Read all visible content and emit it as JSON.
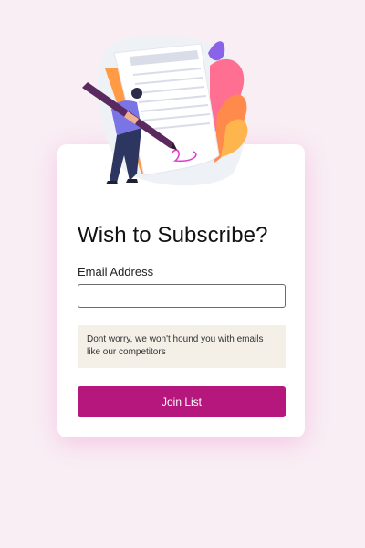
{
  "form": {
    "title": "Wish to Subscribe?",
    "email_label": "Email Address",
    "email_value": "",
    "email_placeholder": "",
    "notice": "Dont worry, we won't hound you with emails like our competitors",
    "button_label": "Join List"
  },
  "colors": {
    "background": "#f9eef4",
    "card": "#ffffff",
    "accent": "#b5177d",
    "notice_bg": "#f4f0e8"
  },
  "illustration": {
    "icon": "person-signing-document-illustration"
  }
}
